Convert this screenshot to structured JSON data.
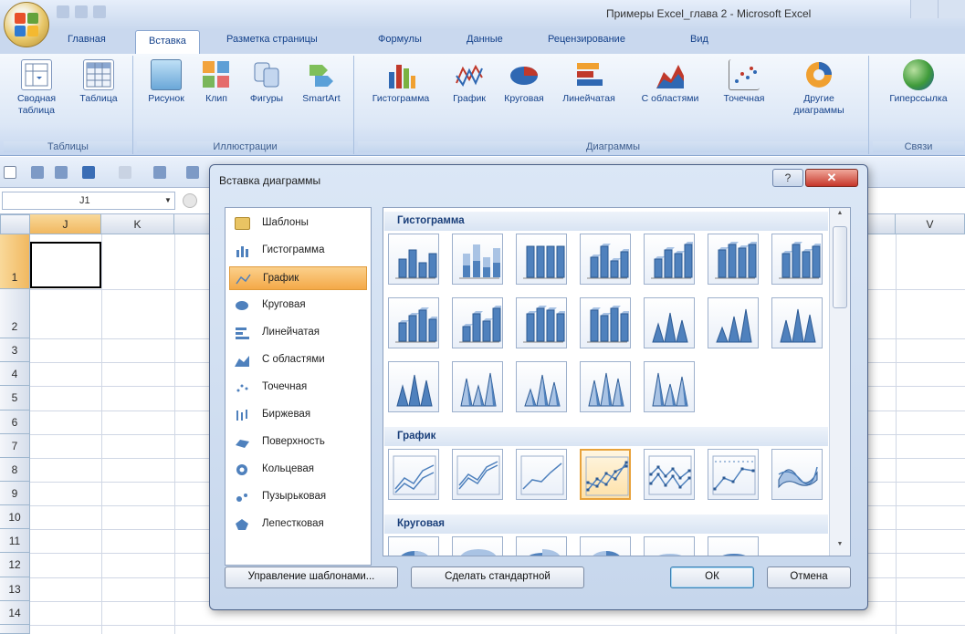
{
  "window": {
    "title": "Примеры Excel_глава 2 - Microsoft Excel"
  },
  "ribbon": {
    "tabs": [
      "Главная",
      "Вставка",
      "Разметка страницы",
      "Формулы",
      "Данные",
      "Рецензирование",
      "Вид"
    ],
    "active_tab": "Вставка",
    "groups": {
      "tables": {
        "label": "Таблицы",
        "buttons": [
          "Сводная таблица",
          "Таблица"
        ]
      },
      "illustrations": {
        "label": "Иллюстрации",
        "buttons": [
          "Рисунок",
          "Клип",
          "Фигуры",
          "SmartArt"
        ]
      },
      "charts": {
        "label": "Диаграммы",
        "buttons": [
          "Гистограмма",
          "График",
          "Круговая",
          "Линейчатая",
          "С областями",
          "Точечная",
          "Другие диаграммы"
        ]
      },
      "links": {
        "label": "Связи",
        "buttons": [
          "Гиперссылка"
        ]
      }
    }
  },
  "formula_bar": {
    "name_box": "J1"
  },
  "sheet": {
    "columns": [
      "J",
      "K",
      "V"
    ],
    "rows": [
      "1",
      "2",
      "3",
      "4",
      "5",
      "6",
      "7",
      "8",
      "9",
      "10",
      "11",
      "12",
      "13",
      "14"
    ]
  },
  "dialog": {
    "title": "Вставка диаграммы",
    "help": "?",
    "close": "✕",
    "categories": [
      "Шаблоны",
      "Гистограмма",
      "График",
      "Круговая",
      "Линейчатая",
      "С областями",
      "Точечная",
      "Биржевая",
      "Поверхность",
      "Кольцевая",
      "Пузырьковая",
      "Лепестковая"
    ],
    "selected_category": "График",
    "sections": [
      "Гистограмма",
      "График",
      "Круговая"
    ],
    "selected_thumbnail": "График — 4",
    "buttons": {
      "manage_templates": "Управление шаблонами...",
      "set_default": "Сделать стандартной",
      "ok": "ОК",
      "cancel": "Отмена"
    }
  },
  "colors": {
    "accent": "#15428b",
    "selection": "#f4a948",
    "chart_blue": "#4f81bd"
  }
}
